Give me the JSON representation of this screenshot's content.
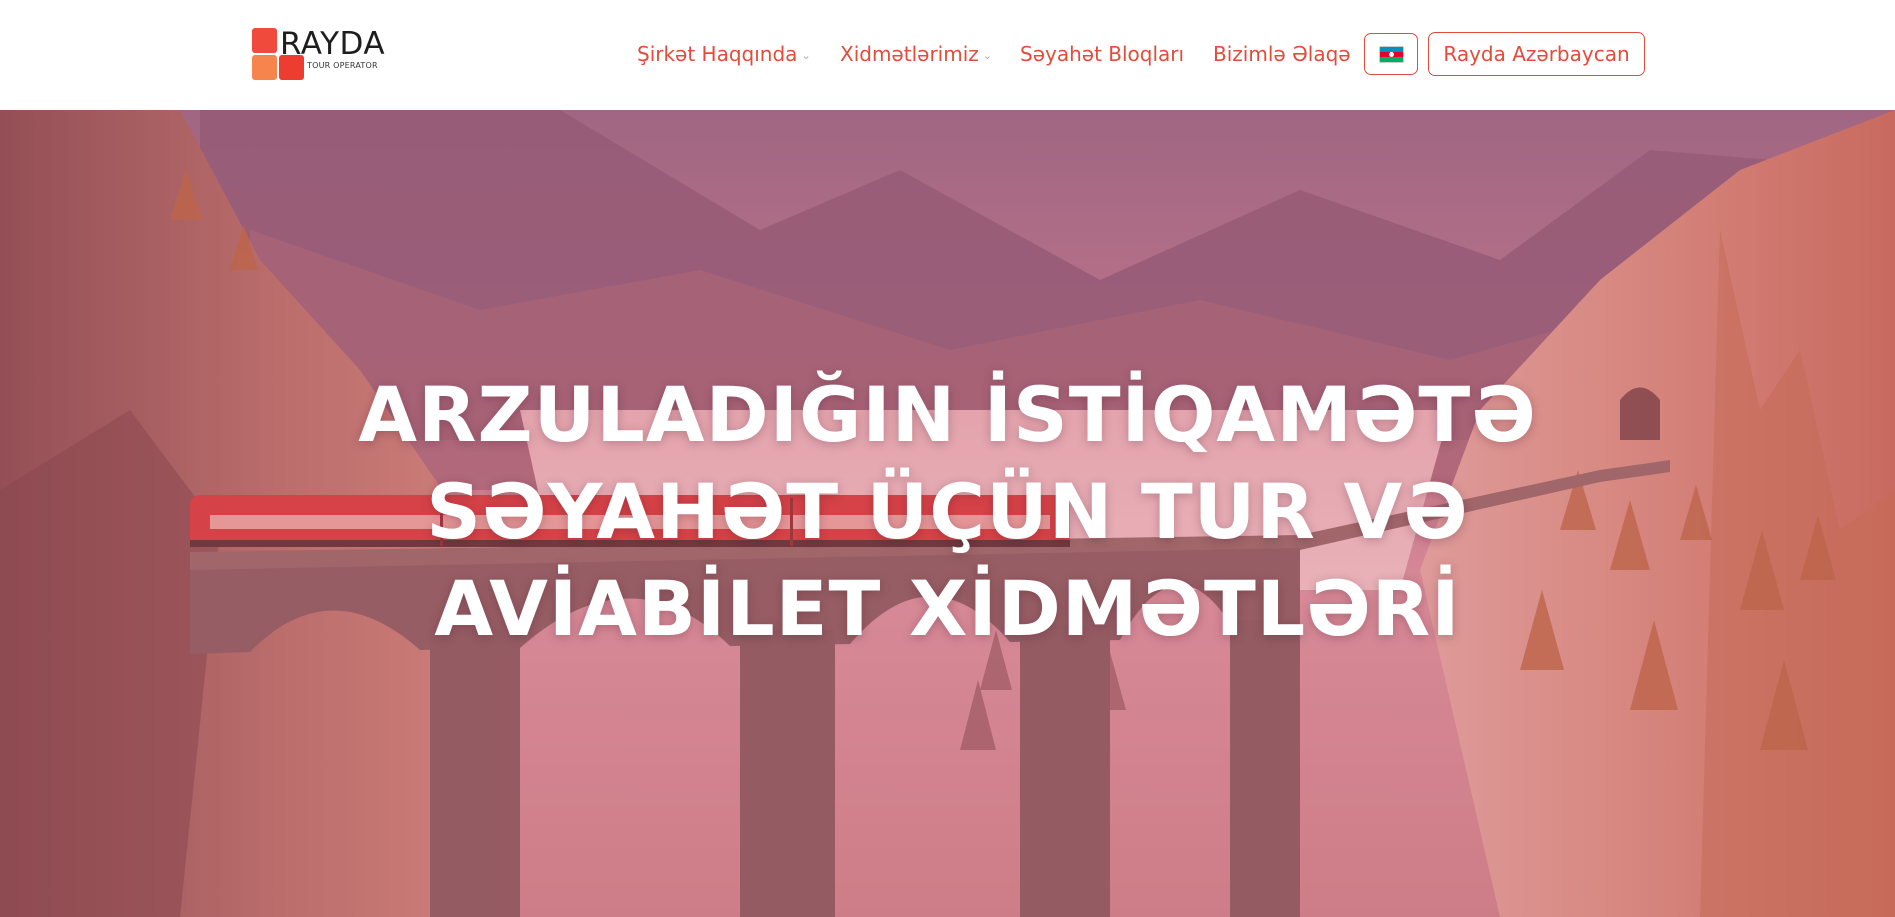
{
  "header": {
    "logo": {
      "word": "RAYDA",
      "subtitle": "TOUR OPERATOR"
    },
    "nav": [
      {
        "label": "Şirkət Haqqında",
        "has_dropdown": true
      },
      {
        "label": "Xidmətlərimiz",
        "has_dropdown": true
      },
      {
        "label": "Səyahət Bloqları",
        "has_dropdown": false
      },
      {
        "label": "Bizimlə Əlaqə",
        "has_dropdown": false
      }
    ],
    "language_icon": "azerbaijan-flag-icon",
    "cta_label": "Rayda Azərbaycan"
  },
  "hero": {
    "title_lines": [
      "ARZULADIĞIN İSTİQAMƏTƏ",
      "SƏYAHƏT ÜÇÜN TUR VƏ",
      "AVİABİLET XİDMƏTLƏRİ"
    ]
  },
  "colors": {
    "accent": "#e34b3a",
    "overlay": "#d65c6a"
  }
}
